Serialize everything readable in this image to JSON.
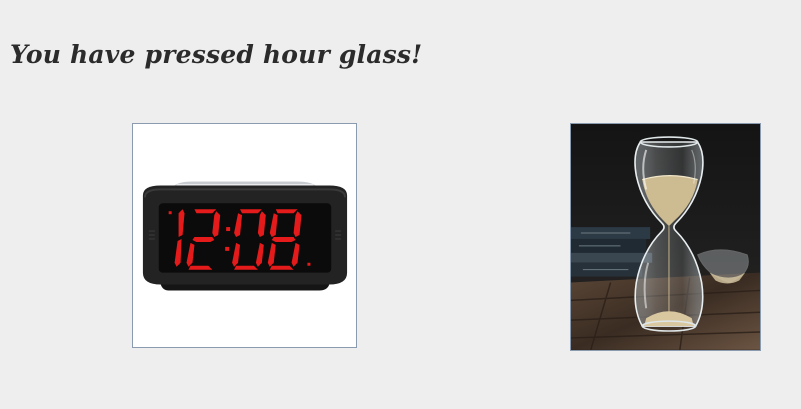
{
  "status": {
    "message": "You have pressed hour glass!"
  },
  "buttons": {
    "clock": {
      "icon": "digital-alarm-clock-icon",
      "display_time": "12:08"
    },
    "hourglass": {
      "icon": "hourglass-icon"
    }
  },
  "colors": {
    "background": "#eeeeee",
    "text": "#2b2b2b",
    "button_border": "#8a9bb0",
    "clock_digits": "#e51b1b"
  }
}
